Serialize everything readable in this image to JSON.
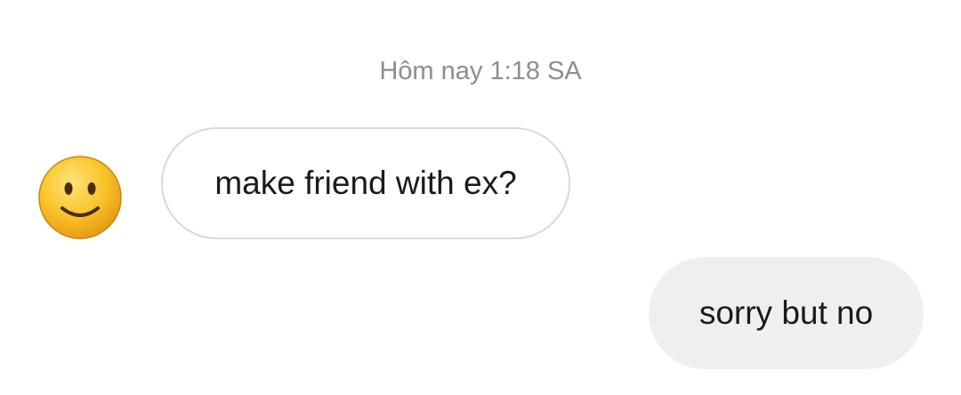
{
  "conversation": {
    "timestamp": "Hôm nay 1:18 SA",
    "messages": [
      {
        "direction": "incoming",
        "text": "make friend with ex?",
        "avatar_icon": "slightly-smiling-face-emoji"
      },
      {
        "direction": "outgoing",
        "text": "sorry but no"
      }
    ]
  },
  "colors": {
    "timestamp": "#8e8e8e",
    "incoming_border": "#d9d9d9",
    "outgoing_bg": "#efefef",
    "text": "#1a1a1a",
    "emoji_face": "#f7c325"
  }
}
